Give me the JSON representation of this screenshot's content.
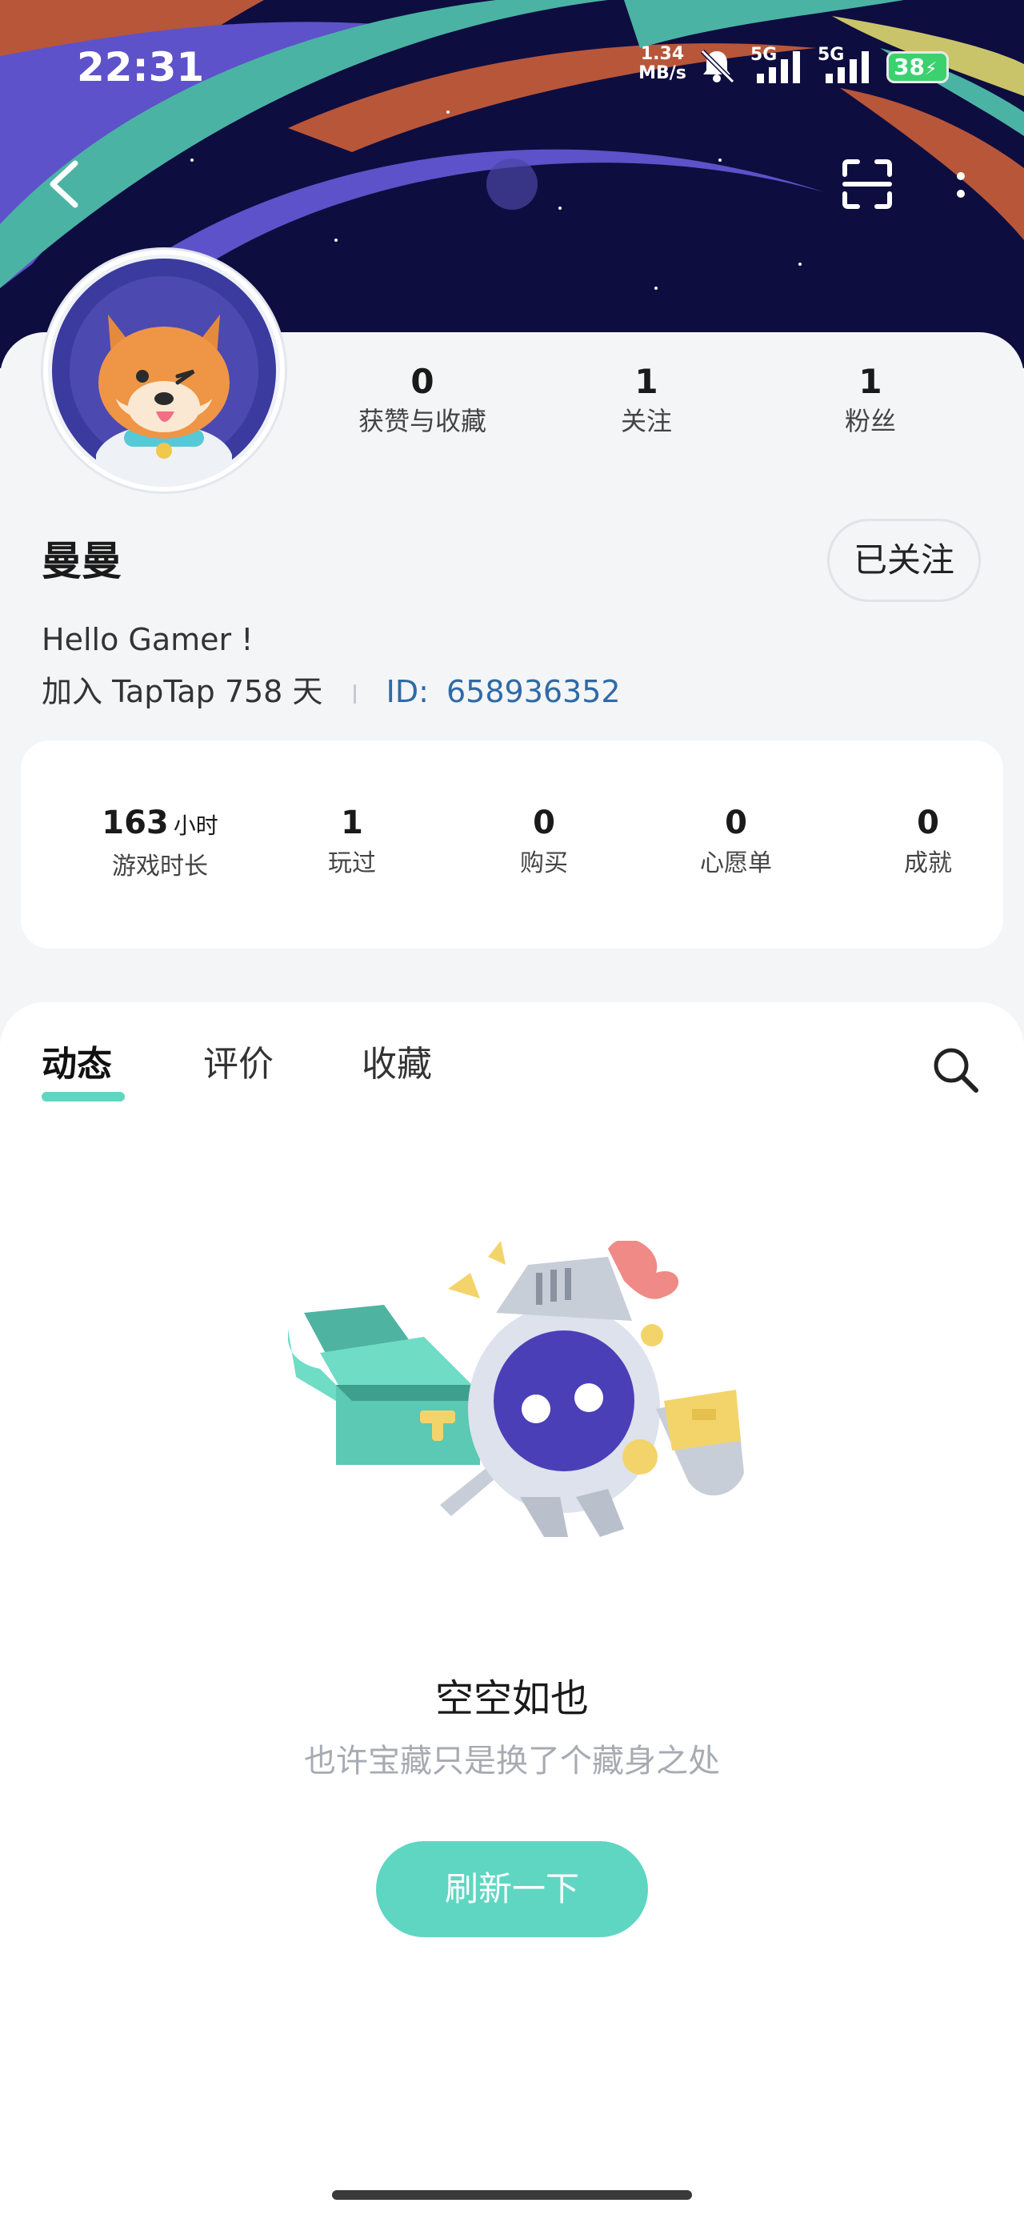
{
  "status_bar": {
    "time": "22:31",
    "net_speed_value": "1.34",
    "net_speed_unit": "MB/s",
    "signal1_label": "5G",
    "signal2_label": "5G",
    "battery": "38"
  },
  "header_icons": {
    "back": "chevron-left-icon",
    "scan": "scan-icon",
    "more": "more-vertical-icon"
  },
  "profile": {
    "name": "曼曼",
    "bio": "Hello Gamer !",
    "join_text": "加入 TapTap 758 天",
    "id_label": "ID:",
    "id_value": "658936352",
    "follow_button": "已关注",
    "stats": [
      {
        "value": "0",
        "label": "获赞与收藏"
      },
      {
        "value": "1",
        "label": "关注"
      },
      {
        "value": "1",
        "label": "粉丝"
      }
    ]
  },
  "game_stats": [
    {
      "value": "163",
      "unit": "小时",
      "label": "游戏时长"
    },
    {
      "value": "1",
      "label": "玩过"
    },
    {
      "value": "0",
      "label": "购买"
    },
    {
      "value": "0",
      "label": "心愿单"
    },
    {
      "value": "0",
      "label": "成就"
    }
  ],
  "tabs": [
    {
      "label": "动态",
      "active": true
    },
    {
      "label": "评价",
      "active": false
    },
    {
      "label": "收藏",
      "active": false
    }
  ],
  "empty_state": {
    "title": "空空如也",
    "subtitle": "也许宝藏只是换了个藏身之处",
    "button": "刷新一下"
  },
  "colors": {
    "accent": "#5fd6c2",
    "id_link": "#2f6aa6",
    "panel_bg": "#f4f5f7",
    "header_sky": "#0e0d3f"
  }
}
